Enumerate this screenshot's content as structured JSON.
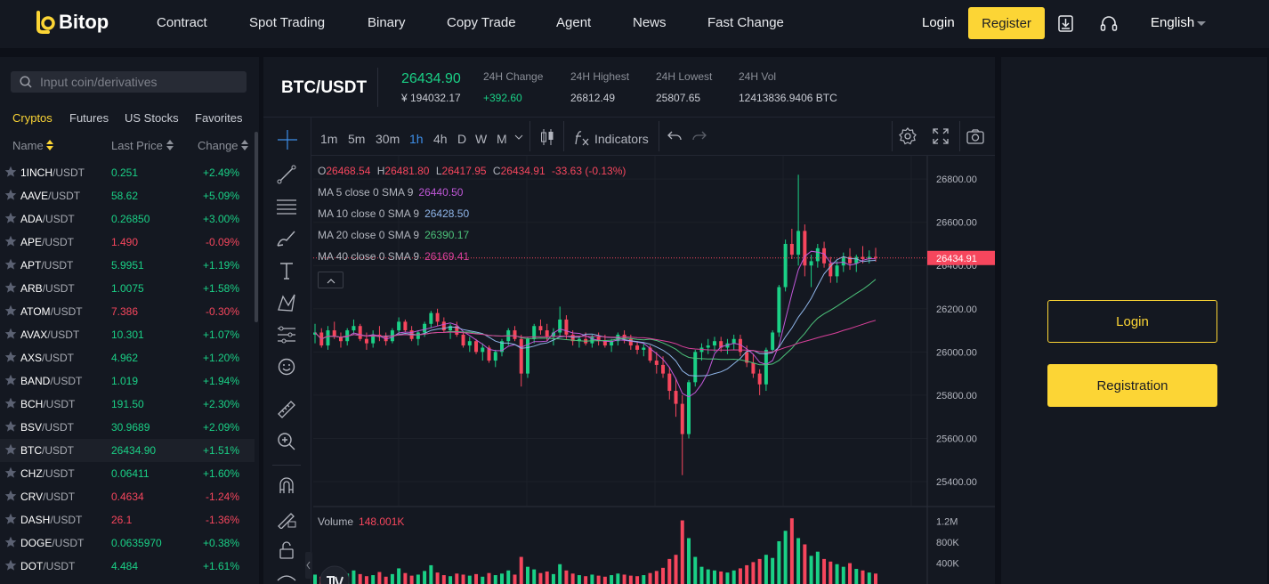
{
  "header": {
    "logo_text": "Bitop",
    "nav": [
      "Contract",
      "Spot Trading",
      "Binary",
      "Copy Trade",
      "Agent",
      "News",
      "Fast Change"
    ],
    "login_label": "Login",
    "register_label": "Register",
    "language": "English"
  },
  "market": {
    "search_placeholder": "Input coin/derivatives",
    "tabs": [
      "Cryptos",
      "Futures",
      "US Stocks",
      "Favorites"
    ],
    "active_tab": "Cryptos",
    "columns": {
      "name": "Name",
      "last_price": "Last Price",
      "change": "Change"
    },
    "quote": "/USDT",
    "rows": [
      {
        "base": "1INCH",
        "price": "0.251",
        "change": "+2.49%",
        "dir": "up"
      },
      {
        "base": "AAVE",
        "price": "58.62",
        "change": "+5.09%",
        "dir": "up"
      },
      {
        "base": "ADA",
        "price": "0.26850",
        "change": "+3.00%",
        "dir": "up"
      },
      {
        "base": "APE",
        "price": "1.490",
        "change": "-0.09%",
        "dir": "dn"
      },
      {
        "base": "APT",
        "price": "5.9951",
        "change": "+1.19%",
        "dir": "up"
      },
      {
        "base": "ARB",
        "price": "1.0075",
        "change": "+1.58%",
        "dir": "up"
      },
      {
        "base": "ATOM",
        "price": "7.386",
        "change": "-0.30%",
        "dir": "dn"
      },
      {
        "base": "AVAX",
        "price": "10.301",
        "change": "+1.07%",
        "dir": "up"
      },
      {
        "base": "AXS",
        "price": "4.962",
        "change": "+1.20%",
        "dir": "up"
      },
      {
        "base": "BAND",
        "price": "1.019",
        "change": "+1.94%",
        "dir": "up"
      },
      {
        "base": "BCH",
        "price": "191.50",
        "change": "+2.30%",
        "dir": "up"
      },
      {
        "base": "BSV",
        "price": "30.9689",
        "change": "+2.09%",
        "dir": "up"
      },
      {
        "base": "BTC",
        "price": "26434.90",
        "change": "+1.51%",
        "dir": "up"
      },
      {
        "base": "CHZ",
        "price": "0.06411",
        "change": "+1.60%",
        "dir": "up"
      },
      {
        "base": "CRV",
        "price": "0.4634",
        "change": "-1.24%",
        "dir": "dn"
      },
      {
        "base": "DASH",
        "price": "26.1",
        "change": "-1.36%",
        "dir": "dn"
      },
      {
        "base": "DOGE",
        "price": "0.0635970",
        "change": "+0.38%",
        "dir": "up"
      },
      {
        "base": "DOT",
        "price": "4.484",
        "change": "+1.61%",
        "dir": "up"
      }
    ]
  },
  "ticker": {
    "pair": "BTC/USDT",
    "last": "26434.90",
    "cny": "¥ 194032.17",
    "change_label": "24H Change",
    "change_value": "+392.60",
    "high_label": "24H Highest",
    "high_value": "26812.49",
    "low_label": "24H Lowest",
    "low_value": "25807.65",
    "vol_label": "24H Vol",
    "vol_value": "12413836.9406 BTC"
  },
  "toolbar": {
    "intervals": [
      "1m",
      "5m",
      "30m",
      "1h",
      "4h",
      "D",
      "W",
      "M"
    ],
    "active_interval": "1h",
    "indicators_label": "Indicators"
  },
  "legend": {
    "o_label": "O",
    "o": "26468.54",
    "h_label": "H",
    "h": "26481.80",
    "l_label": "L",
    "l": "26417.95",
    "c_label": "C",
    "c": "26434.91",
    "chg": "-33.63 (-0.13%)",
    "ma": [
      {
        "label": "MA 5 close 0 SMA 9",
        "value": "26440.50",
        "color": "#c058d8"
      },
      {
        "label": "MA 10 close 0 SMA 9",
        "value": "26428.50",
        "color": "#8fb5e8"
      },
      {
        "label": "MA 20 close 0 SMA 9",
        "value": "26390.17",
        "color": "#4cc27a"
      },
      {
        "label": "MA 40 close 0 SMA 9",
        "value": "26169.41",
        "color": "#d8409a"
      }
    ],
    "volume_label": "Volume",
    "volume_value": "148.001K"
  },
  "chart_data": {
    "type": "candlestick",
    "y_ticks": [
      "26800.00",
      "26600.00",
      "26400.00",
      "26200.00",
      "26000.00",
      "25800.00",
      "25600.00",
      "25400.00"
    ],
    "ylim": [
      25330,
      26850
    ],
    "last_price_tag": "26434.91",
    "volume_ticks": [
      "1.2M",
      "800K",
      "400K"
    ],
    "volume_ylim": [
      0,
      1400
    ],
    "candles": [
      [
        26080,
        26130,
        26040,
        26090
      ],
      [
        26090,
        26110,
        26020,
        26030
      ],
      [
        26030,
        26120,
        26010,
        26100
      ],
      [
        26100,
        26140,
        26060,
        26070
      ],
      [
        26070,
        26090,
        26020,
        26050
      ],
      [
        26050,
        26110,
        26030,
        26100
      ],
      [
        26100,
        26150,
        26080,
        26120
      ],
      [
        26120,
        26130,
        26050,
        26060
      ],
      [
        26060,
        26090,
        26010,
        26040
      ],
      [
        26040,
        26100,
        26020,
        26080
      ],
      [
        26080,
        26120,
        26050,
        26070
      ],
      [
        26070,
        26090,
        26030,
        26050
      ],
      [
        26050,
        26110,
        26040,
        26100
      ],
      [
        26100,
        26160,
        26080,
        26140
      ],
      [
        26140,
        26150,
        26090,
        26100
      ],
      [
        26100,
        26120,
        26050,
        26060
      ],
      [
        26060,
        26100,
        26030,
        26090
      ],
      [
        26090,
        26140,
        26070,
        26130
      ],
      [
        26130,
        26190,
        26110,
        26180
      ],
      [
        26180,
        26200,
        26120,
        26140
      ],
      [
        26140,
        26160,
        26090,
        26100
      ],
      [
        26100,
        26130,
        26060,
        26120
      ],
      [
        26120,
        26140,
        26070,
        26080
      ],
      [
        26080,
        26090,
        26020,
        26030
      ],
      [
        26030,
        26070,
        26000,
        26050
      ],
      [
        26050,
        26060,
        25990,
        26000
      ],
      [
        26000,
        26040,
        25960,
        26020
      ],
      [
        26020,
        26030,
        25950,
        25960
      ],
      [
        25960,
        26010,
        25930,
        26000
      ],
      [
        26000,
        26060,
        25980,
        26050
      ],
      [
        26050,
        26110,
        26030,
        26100
      ],
      [
        26100,
        26120,
        26050,
        26060
      ],
      [
        26060,
        26080,
        25840,
        25900
      ],
      [
        25900,
        26070,
        25880,
        26060
      ],
      [
        26060,
        26130,
        26040,
        26120
      ],
      [
        26120,
        26150,
        26080,
        26100
      ],
      [
        26100,
        26130,
        26050,
        26070
      ],
      [
        26070,
        26110,
        26030,
        26090
      ],
      [
        26090,
        26210,
        26070,
        26150
      ],
      [
        26150,
        26170,
        26060,
        26080
      ],
      [
        26080,
        26100,
        26030,
        26050
      ],
      [
        26050,
        26070,
        26020,
        26060
      ],
      [
        26060,
        26090,
        26030,
        26040
      ],
      [
        26040,
        26080,
        26020,
        26070
      ],
      [
        26070,
        26090,
        26030,
        26050
      ],
      [
        26050,
        26080,
        26020,
        26030
      ],
      [
        26030,
        26060,
        26000,
        26050
      ],
      [
        26050,
        26090,
        26030,
        26080
      ],
      [
        26080,
        26100,
        26040,
        26060
      ],
      [
        26060,
        26080,
        26010,
        26030
      ],
      [
        26030,
        26050,
        25990,
        26010
      ],
      [
        26010,
        26040,
        25980,
        26020
      ],
      [
        26020,
        26030,
        25950,
        25960
      ],
      [
        25960,
        26000,
        25900,
        25940
      ],
      [
        25940,
        25980,
        25880,
        25900
      ],
      [
        25900,
        25930,
        25780,
        25820
      ],
      [
        25820,
        25880,
        25700,
        25760
      ],
      [
        25760,
        25800,
        25430,
        25620
      ],
      [
        25620,
        25870,
        25600,
        25860
      ],
      [
        25860,
        26010,
        25840,
        26000
      ],
      [
        26000,
        26040,
        25960,
        26020
      ],
      [
        26020,
        26060,
        25990,
        26030
      ],
      [
        26030,
        26070,
        26000,
        26050
      ],
      [
        26050,
        26070,
        26000,
        26020
      ],
      [
        26020,
        26060,
        25990,
        26040
      ],
      [
        26040,
        26080,
        26010,
        26060
      ],
      [
        26060,
        26080,
        25980,
        26000
      ],
      [
        26000,
        26030,
        25930,
        25950
      ],
      [
        25950,
        25990,
        25880,
        25900
      ],
      [
        25900,
        25920,
        25800,
        25850
      ],
      [
        25850,
        26020,
        25820,
        26010
      ],
      [
        26010,
        26100,
        26000,
        26090
      ],
      [
        26090,
        26310,
        26070,
        26300
      ],
      [
        26300,
        26520,
        26280,
        26500
      ],
      [
        26500,
        26570,
        26430,
        26450
      ],
      [
        26450,
        26820,
        26400,
        26560
      ],
      [
        26560,
        26590,
        26350,
        26400
      ],
      [
        26400,
        26450,
        26300,
        26420
      ],
      [
        26420,
        26500,
        26390,
        26480
      ],
      [
        26480,
        26510,
        26390,
        26410
      ],
      [
        26410,
        26440,
        26320,
        26350
      ],
      [
        26350,
        26420,
        26320,
        26400
      ],
      [
        26400,
        26460,
        26370,
        26440
      ],
      [
        26440,
        26480,
        26380,
        26410
      ],
      [
        26410,
        26450,
        26370,
        26440
      ],
      [
        26440,
        26490,
        26410,
        26430
      ],
      [
        26430,
        26470,
        26410,
        26440
      ],
      [
        26440,
        26482,
        26418,
        26435
      ]
    ],
    "volumes": [
      180,
      140,
      220,
      160,
      120,
      200,
      260,
      190,
      150,
      170,
      230,
      140,
      190,
      300,
      210,
      160,
      180,
      250,
      360,
      220,
      170,
      150,
      200,
      180,
      160,
      190,
      140,
      210,
      170,
      200,
      260,
      180,
      520,
      330,
      280,
      210,
      240,
      190,
      380,
      260,
      200,
      170,
      150,
      180,
      160,
      140,
      170,
      200,
      180,
      160,
      150,
      170,
      210,
      250,
      310,
      480,
      560,
      1220,
      880,
      520,
      330,
      280,
      260,
      240,
      220,
      260,
      300,
      360,
      420,
      480,
      560,
      500,
      820,
      1020,
      1260,
      880,
      760,
      540,
      620,
      480,
      430,
      380,
      330,
      400,
      290,
      260,
      220,
      200
    ]
  },
  "right": {
    "login_label": "Login",
    "register_label": "Registration"
  }
}
